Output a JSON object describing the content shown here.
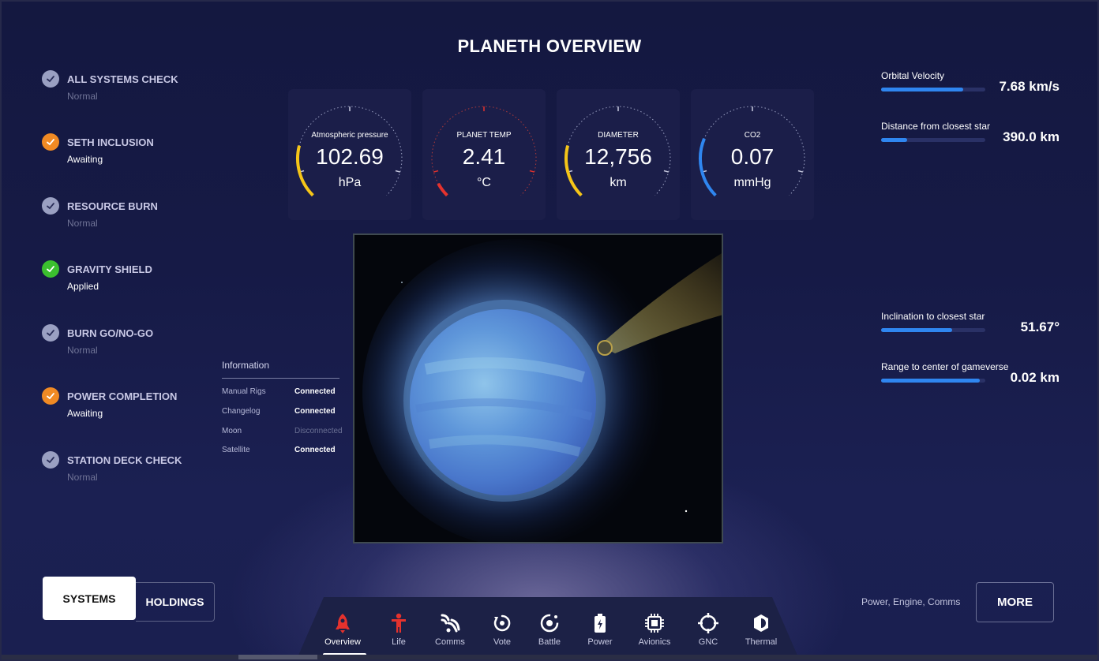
{
  "page": {
    "title": "PLANETH OVERVIEW"
  },
  "colors": {
    "accent_blue": "#2f86f0",
    "yellow": "#f5c518",
    "red": "#e5322d",
    "orange": "#f08a24",
    "green": "#3bbf2f",
    "grey_check": "#9aa0c2"
  },
  "checklist": [
    {
      "label": "ALL SYSTEMS CHECK",
      "status": "Normal",
      "state": "normal"
    },
    {
      "label": "SETH INCLUSION",
      "status": "Awaiting",
      "state": "awaiting"
    },
    {
      "label": "RESOURCE BURN",
      "status": "Normal",
      "state": "normal"
    },
    {
      "label": "GRAVITY SHIELD",
      "status": "Applied",
      "state": "applied"
    },
    {
      "label": "BURN GO/NO-GO",
      "status": "Normal",
      "state": "normal"
    },
    {
      "label": "POWER COMPLETION",
      "status": "Awaiting",
      "state": "awaiting"
    },
    {
      "label": "STATION DECK CHECK",
      "status": "Normal",
      "state": "normal"
    }
  ],
  "gauges": [
    {
      "label": "Atmospheric pressure",
      "value": "102.69",
      "unit": "hPa",
      "color": "#f5c518",
      "level": 0.22
    },
    {
      "label": "PLANET TEMP",
      "value": "2.41",
      "unit": "°C",
      "color": "#e5322d",
      "level": 0.06
    },
    {
      "label": "DIAMETER",
      "value": "12,756",
      "unit": "km",
      "color": "#f5c518",
      "level": 0.22
    },
    {
      "label": "CO2",
      "value": "0.07",
      "unit": "mmHg",
      "color": "#2f86f0",
      "level": 0.25
    }
  ],
  "information": {
    "title": "Information",
    "rows": [
      {
        "key": "Manual Rigs",
        "value": "Connected",
        "connected": true
      },
      {
        "key": "Changelog",
        "value": "Connected",
        "connected": true
      },
      {
        "key": "Moon",
        "value": "Disconnected",
        "connected": false
      },
      {
        "key": "Satellite",
        "value": "Connected",
        "connected": true
      }
    ]
  },
  "stats": [
    {
      "label": "Orbital Velocity",
      "value": "7.68 km/s",
      "level": 0.79
    },
    {
      "label": "Distance from closest star",
      "value": "390.0 km",
      "level": 0.25
    },
    {
      "label": "Inclination to closest star",
      "value": "51.67°",
      "level": 0.68
    },
    {
      "label": "Range to center of gameverse",
      "value": "0.02 km",
      "level": 0.95
    }
  ],
  "toggle": {
    "systems": "SYSTEMS",
    "holdings": "HOLDINGS"
  },
  "more": {
    "caption": "Power, Engine, Comms",
    "button": "MORE"
  },
  "nav": [
    {
      "label": "Overview",
      "icon": "rocket-icon",
      "active": true
    },
    {
      "label": "Life",
      "icon": "person-icon",
      "active": false
    },
    {
      "label": "Comms",
      "icon": "signal-icon",
      "active": false
    },
    {
      "label": "Vote",
      "icon": "vote-icon",
      "active": false
    },
    {
      "label": "Battle",
      "icon": "target-icon",
      "active": false
    },
    {
      "label": "Power",
      "icon": "battery-icon",
      "active": false
    },
    {
      "label": "Avionics",
      "icon": "chip-icon",
      "active": false
    },
    {
      "label": "GNC",
      "icon": "crosshair-icon",
      "active": false
    },
    {
      "label": "Thermal",
      "icon": "thermal-icon",
      "active": false
    }
  ]
}
